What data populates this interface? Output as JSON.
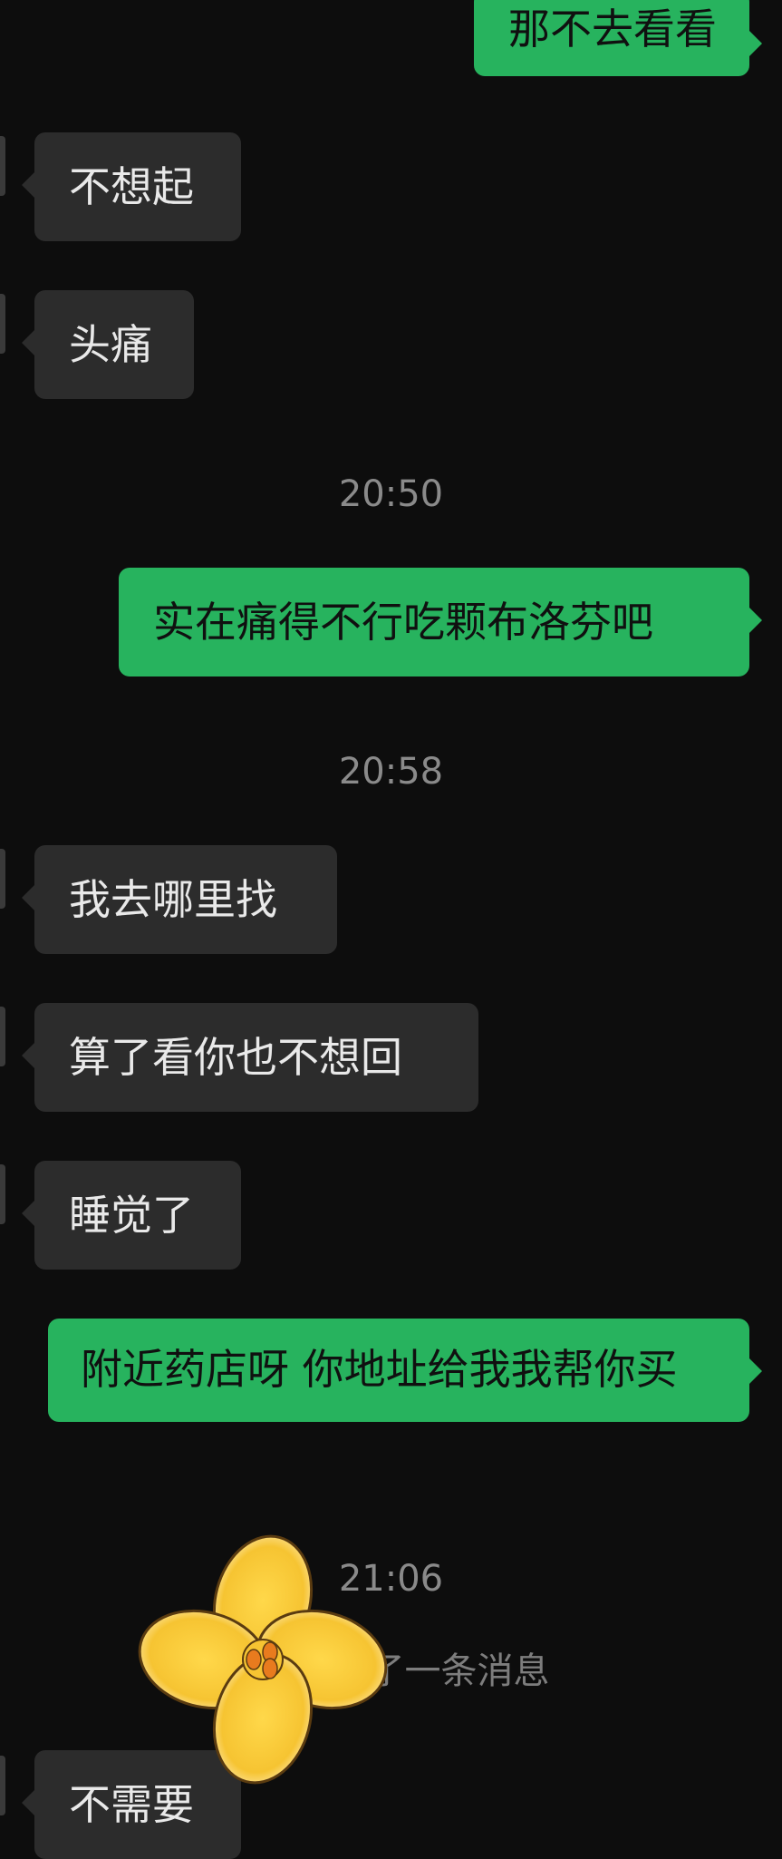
{
  "messages": [
    {
      "side": "out",
      "text": "那不去看看"
    },
    {
      "side": "in",
      "text": "不想起"
    },
    {
      "side": "in",
      "text": "头痛"
    },
    {
      "side": "time",
      "text": "20:50"
    },
    {
      "side": "out",
      "text": "实在痛得不行吃颗布洛芬吧"
    },
    {
      "side": "time",
      "text": "20:58"
    },
    {
      "side": "in",
      "text": "我去哪里找"
    },
    {
      "side": "in",
      "text": "算了看你也不想回"
    },
    {
      "side": "in",
      "text": "睡觉了"
    },
    {
      "side": "out",
      "text": "附近药店呀  你地址给我我帮你买"
    },
    {
      "side": "time",
      "text": "21:06"
    },
    {
      "side": "system",
      "text": "了一条消息"
    },
    {
      "side": "in",
      "text": "不需要"
    }
  ],
  "colors": {
    "background": "#0d0d0d",
    "incoming_bubble": "#2c2c2c",
    "outgoing_bubble": "#27b35e",
    "timestamp": "#8a8a8a"
  },
  "sticker": {
    "name": "flower-sticker-icon"
  }
}
